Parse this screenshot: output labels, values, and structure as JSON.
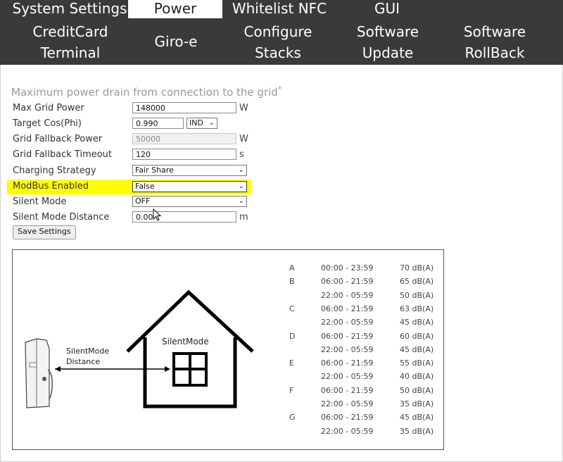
{
  "nav": {
    "row1": [
      "System Settings",
      "Power",
      "Whitelist NFC",
      "GUI"
    ],
    "active": "Power",
    "row2": [
      {
        "line1": "CreditCard",
        "line2": "Terminal"
      },
      {
        "line1": "Giro-e",
        "line2": ""
      },
      {
        "line1": "Configure",
        "line2": "Stacks"
      },
      {
        "line1": "Software",
        "line2": "Update"
      },
      {
        "line1": "Software",
        "line2": "RollBack"
      }
    ]
  },
  "form": {
    "heading": "Maximum power drain from connection to the grid",
    "heading_mark": "*",
    "max_grid_power": {
      "label": "Max Grid Power",
      "value": "148000",
      "unit": "W"
    },
    "target_cos": {
      "label": "Target Cos(Phi)",
      "value": "0.990",
      "select": "IND"
    },
    "grid_fallback_power": {
      "label": "Grid Fallback Power",
      "value": "50000",
      "unit": "W"
    },
    "grid_fallback_timeout": {
      "label": "Grid Fallback Timeout",
      "value": "120",
      "unit": "s"
    },
    "charging_strategy": {
      "label": "Charging Strategy",
      "value": "Fair Share"
    },
    "modbus_enabled": {
      "label": "ModBus Enabled",
      "value": "False"
    },
    "silent_mode": {
      "label": "Silent Mode",
      "value": "OFF"
    },
    "silent_mode_distance": {
      "label": "Silent Mode Distance",
      "value": "0.00",
      "unit": "m"
    },
    "save_label": "Save Settings"
  },
  "diagram": {
    "house_label": "SilentMode",
    "distance_label_1": "SilentMode",
    "distance_label_2": "Distance",
    "levels": [
      {
        "level": "A",
        "time": "00:00 - 23:59",
        "db": "70 dB(A)"
      },
      {
        "level": "B",
        "time": "06:00 - 21:59",
        "db": "65 dB(A)"
      },
      {
        "level": "",
        "time": "22:00 - 05:59",
        "db": "50 dB(A)"
      },
      {
        "level": "C",
        "time": "06:00 - 21:59",
        "db": "63 dB(A)"
      },
      {
        "level": "",
        "time": "22:00 - 05:59",
        "db": "45 dB(A)"
      },
      {
        "level": "D",
        "time": "06:00 - 21:59",
        "db": "60 dB(A)"
      },
      {
        "level": "",
        "time": "22:00 - 05:59",
        "db": "45 dB(A)"
      },
      {
        "level": "E",
        "time": "06:00 - 21:59",
        "db": "55 dB(A)"
      },
      {
        "level": "",
        "time": "22:00 - 05:59",
        "db": "40 dB(A)"
      },
      {
        "level": "F",
        "time": "06:00 - 21:59",
        "db": "50 dB(A)"
      },
      {
        "level": "",
        "time": "22:00 - 05:59",
        "db": "35 dB(A)"
      },
      {
        "level": "G",
        "time": "06:00 - 21:59",
        "db": "45 dB(A)"
      },
      {
        "level": "",
        "time": "22:00 - 05:59",
        "db": "35 dB(A)"
      }
    ]
  },
  "colors": {
    "nav_bg": "#3a3a3a",
    "highlight": "#ffff00"
  }
}
